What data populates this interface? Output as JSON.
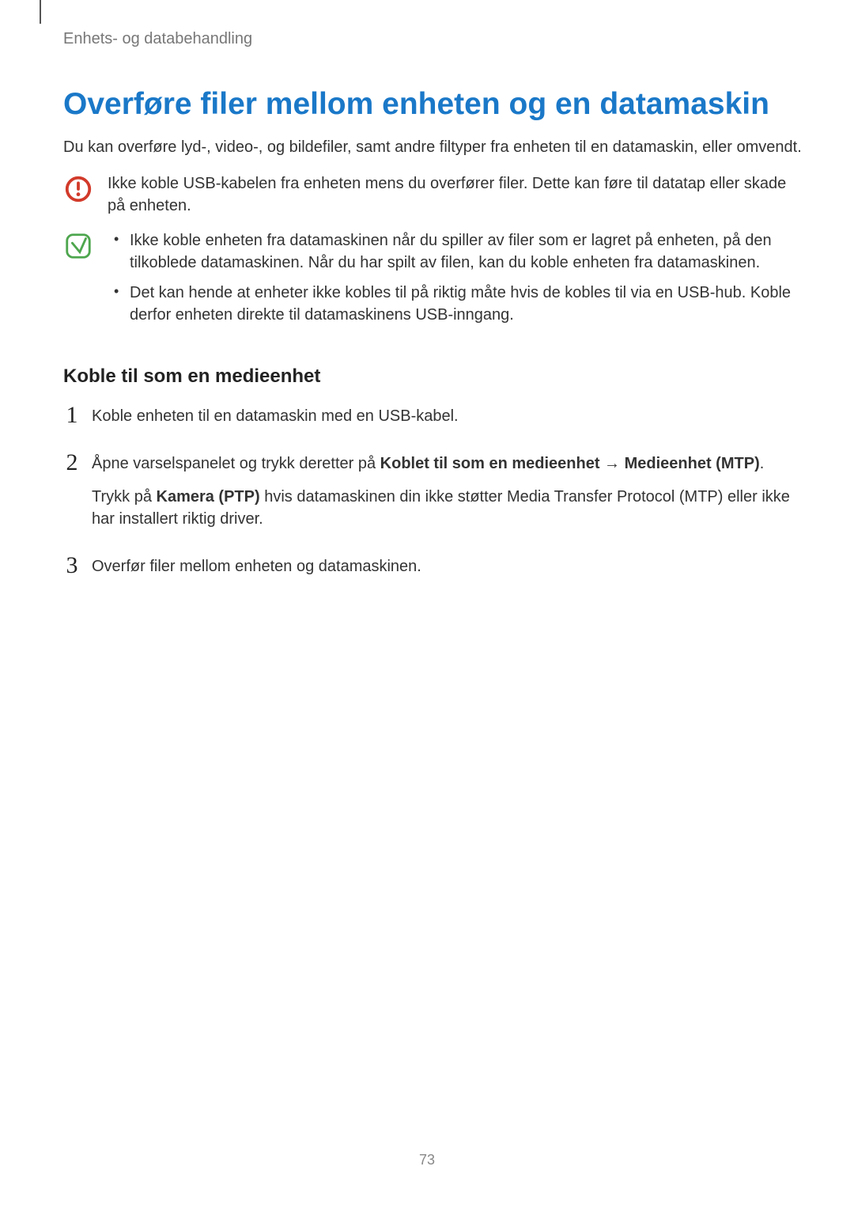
{
  "header": {
    "chapter": "Enhets- og databehandling"
  },
  "main": {
    "title": "Overføre filer mellom enheten og en datamaskin",
    "intro": "Du kan overføre lyd-, video-, og bildefiler, samt andre filtyper fra enheten til en datamaskin, eller omvendt.",
    "callout_warning": "Ikke koble USB-kabelen fra enheten mens du overfører filer. Dette kan føre til datatap eller skade på enheten.",
    "callout_tips": [
      "Ikke koble enheten fra datamaskinen når du spiller av filer som er lagret på enheten, på den tilkoblede datamaskinen. Når du har spilt av filen, kan du koble enheten fra datamaskinen.",
      "Det kan hende at enheter ikke kobles til på riktig måte hvis de kobles til via en USB-hub. Koble derfor enheten direkte til datamaskinens USB-inngang."
    ],
    "section_title": "Koble til som en medieenhet",
    "steps": {
      "s1_num": "1",
      "s1_text": "Koble enheten til en datamaskin med en USB-kabel.",
      "s2_num": "2",
      "s2_p1_pre": "Åpne varselspanelet og trykk deretter på ",
      "s2_p1_b1": "Koblet til som en medieenhet",
      "s2_p1_arrow": " → ",
      "s2_p1_b2": "Medieenhet (MTP)",
      "s2_p1_post": ".",
      "s2_p2_pre": "Trykk på ",
      "s2_p2_b": "Kamera (PTP)",
      "s2_p2_post": " hvis datamaskinen din ikke støtter Media Transfer Protocol (MTP) eller ikke har installert riktig driver.",
      "s3_num": "3",
      "s3_text": "Overfør filer mellom enheten og datamaskinen."
    }
  },
  "page_number": "73"
}
